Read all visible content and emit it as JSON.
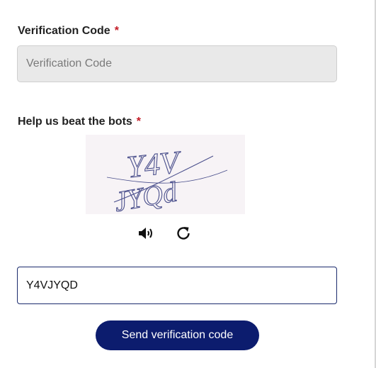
{
  "verification": {
    "label": "Verification Code",
    "required_mark": "*",
    "placeholder": "Verification Code",
    "value": ""
  },
  "captcha": {
    "label": "Help us beat the bots",
    "required_mark": "*",
    "image_text_line1": "Y4V",
    "image_text_line2": "JYQd",
    "audio_icon": "speaker-icon",
    "refresh_icon": "refresh-icon",
    "answer_value": "Y4VJYQD"
  },
  "actions": {
    "send_label": "Send verification code"
  },
  "colors": {
    "primary": "#0c1c6e",
    "required": "#c41b25",
    "input_disabled_bg": "#e9e9e9",
    "captcha_ink": "#4a4f8c",
    "captcha_bg": "#f7f3f6"
  }
}
